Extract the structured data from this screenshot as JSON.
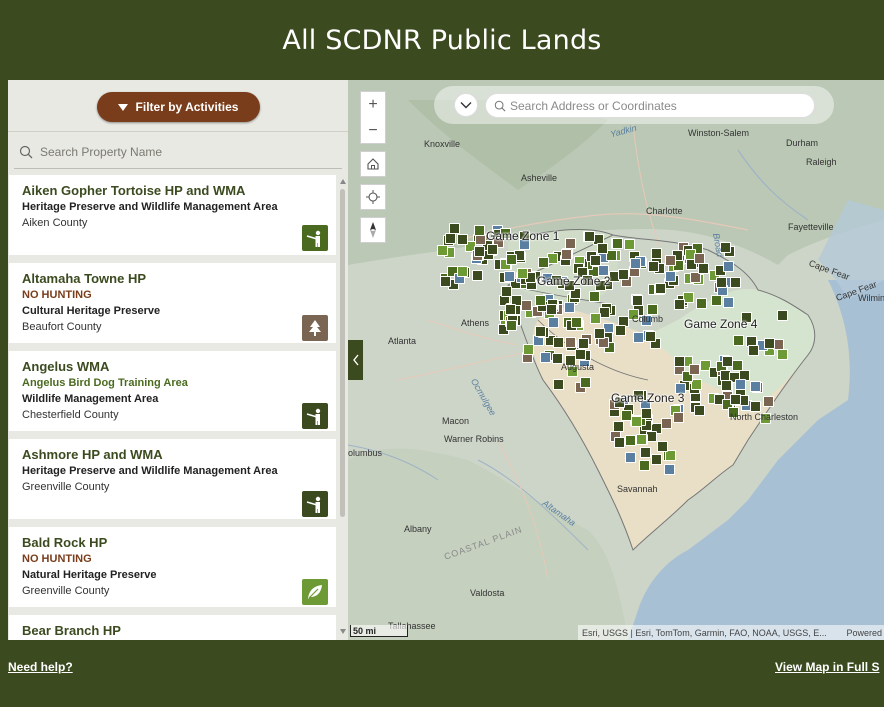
{
  "header": {
    "title": "All SCDNR Public Lands"
  },
  "sidebar": {
    "filter_label": "Filter by Activities",
    "search_placeholder": "Search Property Name",
    "cards": [
      {
        "title": "Aiken Gopher Tortoise HP and WMA",
        "notice": "",
        "subtitle": "",
        "type": "Heritage Preserve and Wildlife Management Area",
        "county": "Aiken County",
        "icon": "hunting-icon",
        "icon_color": "#4a6b1f"
      },
      {
        "title": "Altamaha Towne HP",
        "notice": "NO HUNTING",
        "subtitle": "",
        "type": "Cultural Heritage Preserve",
        "county": "Beaufort County",
        "icon": "tree-icon",
        "icon_color": "#7a6552"
      },
      {
        "title": "Angelus WMA",
        "notice": "",
        "subtitle": "Angelus Bird Dog Training Area",
        "type": "Wildlife Management Area",
        "county": "Chesterfield County",
        "icon": "hunting-icon",
        "icon_color": "#3b4a1f"
      },
      {
        "title": "Ashmore HP and WMA",
        "notice": "",
        "subtitle": "",
        "type": "Heritage Preserve and Wildlife Management Area",
        "county": "Greenville County",
        "icon": "hunting-icon",
        "icon_color": "#3b4a1f"
      },
      {
        "title": "Bald Rock HP",
        "notice": "NO HUNTING",
        "subtitle": "",
        "type": "Natural Heritage Preserve",
        "county": "Greenville County",
        "icon": "leaf-icon",
        "icon_color": "#6e9a35"
      },
      {
        "title": "Bear Branch HP",
        "notice": "",
        "subtitle": "",
        "type": "",
        "county": "",
        "icon": "",
        "icon_color": "#3b4a1f"
      }
    ]
  },
  "map": {
    "search_placeholder": "Search Address or Coordinates",
    "zones": [
      "Game Zone 1",
      "Game Zone 2",
      "Game Zone 3",
      "Game Zone 4"
    ],
    "cities": [
      "Knoxville",
      "Asheville",
      "Winston-Salem",
      "Durham",
      "Raleigh",
      "Charlotte",
      "Fayetteville",
      "Athens",
      "Atlanta",
      "Columb",
      "Augusta",
      "Macon",
      "Warner Robins",
      "olumbus",
      "Albany",
      "Valdosta",
      "Tallahassee",
      "Savannah",
      "North Charleston",
      "Wilmin",
      "Cape Fear",
      "Cape Fear"
    ],
    "scale_label": "50 mi",
    "attribution": "Esri, USGS | Esri, TomTom, Garmin, FAO, NOAA, USGS, E...",
    "powered": "Powered",
    "labels": {
      "yadkin": "Yadkin",
      "broad": "Broad",
      "ocmulgee": "Ocmulgee",
      "altamaha": "Altamaha",
      "coastal_plain": "COASTAL PLAIN"
    }
  },
  "footer": {
    "help": "Need help?",
    "fullscreen": "View Map in Full S"
  }
}
